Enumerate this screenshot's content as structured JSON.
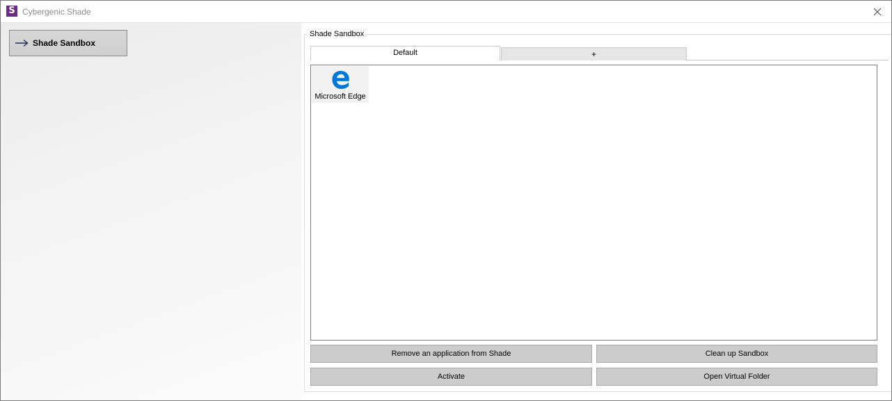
{
  "window": {
    "title": "Cybergenic Shade",
    "app_icon_letter": "S",
    "app_icon_color": "#6b2c86",
    "close_icon": "close-icon"
  },
  "sidebar": {
    "items": [
      {
        "label": "Shade Sandbox",
        "icon": "arrow-right-icon",
        "selected": true
      }
    ]
  },
  "main": {
    "group_label": "Shade Sandbox",
    "tabs": [
      {
        "label": "Default",
        "active": true
      },
      {
        "label": "+",
        "active": false
      }
    ],
    "applications": [
      {
        "name": "Microsoft Edge",
        "icon": "microsoft-edge-icon",
        "icon_color": "#0078d7"
      }
    ],
    "buttons": {
      "remove": "Remove an application from Shade",
      "clean": "Clean up Sandbox",
      "activate": "Activate",
      "open_folder": "Open Virtual Folder"
    }
  }
}
